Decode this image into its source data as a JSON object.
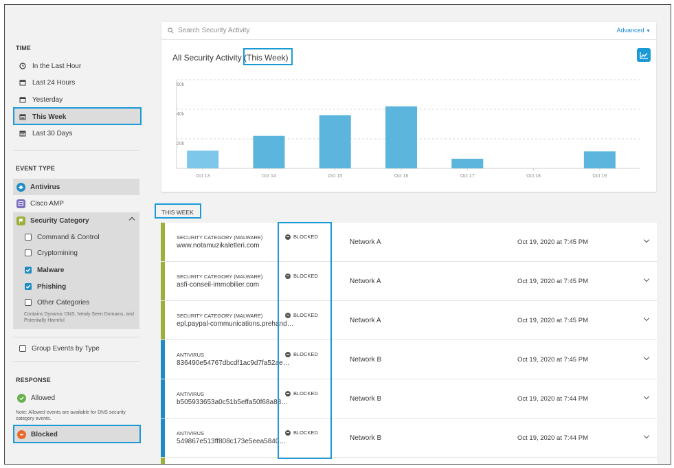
{
  "colors": {
    "accent": "#1b9ad6",
    "bar": "#5bb5dc",
    "bar_light": "#7cc7ea",
    "malware": "#9ab03a",
    "antivirus": "#1e8bc3"
  },
  "sidebar": {
    "time": {
      "heading": "TIME",
      "items": [
        {
          "label": "In the Last Hour",
          "icon": "clock-icon"
        },
        {
          "label": "Last 24 Hours",
          "icon": "calendar-icon"
        },
        {
          "label": "Yesterday",
          "icon": "calendar-icon"
        },
        {
          "label": "This Week",
          "icon": "calendar-icon",
          "selected": true
        },
        {
          "label": "Last 30 Days",
          "icon": "calendar-icon"
        }
      ]
    },
    "event_type": {
      "heading": "EVENT TYPE",
      "antivirus": "Antivirus",
      "cisco_amp": "Cisco AMP",
      "security_category": "Security Category",
      "sub_items": [
        {
          "label": "Command & Control",
          "checked": false
        },
        {
          "label": "Cryptomining",
          "checked": false
        },
        {
          "label": "Malware",
          "checked": true
        },
        {
          "label": "Phishing",
          "checked": true
        },
        {
          "label": "Other Categories",
          "checked": false
        }
      ],
      "other_note": "Contains Dynamic DNS, Newly Seen Domains, and Potentially Harmful",
      "group_label": "Group Events by Type"
    },
    "response": {
      "heading": "RESPONSE",
      "allowed": "Allowed",
      "note": "Note: Allowed events are available for DNS security category events.",
      "blocked": "Blocked"
    }
  },
  "search": {
    "placeholder": "Search Security Activity",
    "advanced": "Advanced"
  },
  "chart_title": "All Security Activity",
  "chart_title_range": "(This Week)",
  "week_label": "THIS WEEK",
  "chart_data": {
    "type": "bar",
    "categories": [
      "Oct 13",
      "Oct 14",
      "Oct 15",
      "Oct 16",
      "Oct 17",
      "Oct 18",
      "Oct 19"
    ],
    "values": [
      12000,
      22000,
      36000,
      42000,
      6500,
      0,
      11500
    ],
    "y_ticks": [
      "20k",
      "40k",
      "60k"
    ],
    "ylim": [
      0,
      60000
    ],
    "grid": true
  },
  "events": [
    {
      "category": "SECURITY CATEGORY (MALWARE)",
      "name": "www.notamuzikaletleri.com",
      "status": "BLOCKED",
      "network": "Network A",
      "time": "Oct 19, 2020 at 7:45 PM",
      "type": "malware"
    },
    {
      "category": "SECURITY CATEGORY (MALWARE)",
      "name": "asfi-conseil-immobilier.com",
      "status": "BLOCKED",
      "network": "Network A",
      "time": "Oct 19, 2020 at 7:45 PM",
      "type": "malware"
    },
    {
      "category": "SECURITY CATEGORY (MALWARE)",
      "name": "epl.paypal-communications.prehand…",
      "status": "BLOCKED",
      "network": "Network A",
      "time": "Oct 19, 2020 at 7:45 PM",
      "type": "malware"
    },
    {
      "category": "ANTIVIRUS",
      "name": "836490e54767dbcdf1ac9d7fa52ae…",
      "status": "BLOCKED",
      "network": "Network B",
      "time": "Oct 19, 2020 at 7:45 PM",
      "type": "antivirus"
    },
    {
      "category": "ANTIVIRUS",
      "name": "b505933653a0c51b5effa50f68a88…",
      "status": "BLOCKED",
      "network": "Network B",
      "time": "Oct 19, 2020 at 7:44 PM",
      "type": "antivirus"
    },
    {
      "category": "ANTIVIRUS",
      "name": "549867e513ff808c173e5eea5840…",
      "status": "BLOCKED",
      "network": "Network B",
      "time": "Oct 19, 2020 at 7:44 PM",
      "type": "antivirus"
    }
  ]
}
